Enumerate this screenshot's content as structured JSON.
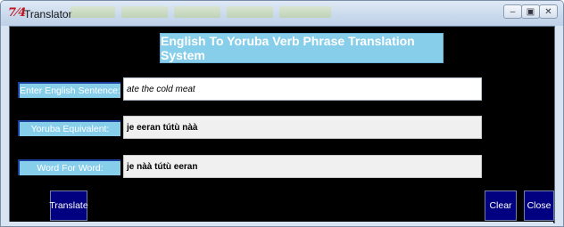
{
  "window": {
    "title": "Translator",
    "app_icon_glyph": "7⁤4",
    "controls": {
      "minimize_glyph": "–",
      "maximize_glyph": "▣",
      "close_glyph": "✕"
    }
  },
  "header": {
    "title": "English To Yoruba Verb Phrase Translation System"
  },
  "form": {
    "english": {
      "label": "Enter English Sentence:",
      "value": "ate the cold meat"
    },
    "yoruba": {
      "label": "Yoruba Equivalent:",
      "value": "je eeran tútù nàà"
    },
    "word_for_word": {
      "label": "Word For Word:",
      "value": "je nàà tútù eeran"
    }
  },
  "buttons": {
    "translate": "Translate",
    "clear": "Clear",
    "close": "Close"
  },
  "colors": {
    "label_bg": "#87ceeb",
    "button_bg": "#000080",
    "panel_bg": "#000000"
  }
}
